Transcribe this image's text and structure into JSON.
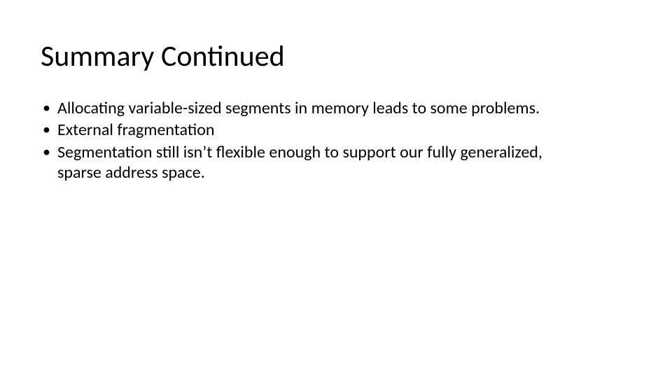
{
  "slide": {
    "title": "Summary Continued",
    "bullets": [
      "Allocating variable-sized segments in memory leads to some problems.",
      "External fragmentation",
      "Segmentation still isn’t flexible enough to support our fully generalized, sparse address space."
    ]
  }
}
